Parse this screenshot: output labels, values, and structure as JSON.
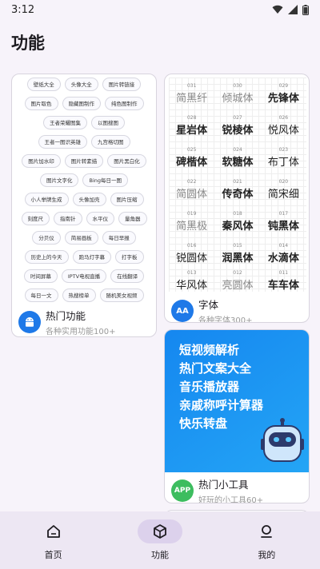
{
  "status_bar": {
    "time": "3:12"
  },
  "page": {
    "title": "功能"
  },
  "hot": {
    "chips": [
      "壁纸大全",
      "头像大全",
      "图片转链接",
      "图片取色",
      "隐藏图制作",
      "纯色图制作",
      "王者荣耀图集",
      "以图搜图",
      "王者一图识英雄",
      "九宫格切图",
      "图片加水印",
      "图片转素描",
      "图片黑白化",
      "图片文字化",
      "Bing每日一图",
      "小人举牌生成",
      "头像加壳",
      "图片压缩",
      "刻度尺",
      "指南针",
      "水平仪",
      "量角器",
      "分贝仪",
      "简易画板",
      "每日早报",
      "历史上的今天",
      "跑马灯字幕",
      "打字板",
      "时间屏幕",
      "IPTV电视直播",
      "在线翻译",
      "每日一文",
      "热搜榜单",
      "随机美女视频"
    ],
    "title": "热门功能",
    "subtitle": "各种实用功能100+",
    "badge_icon": "android-icon"
  },
  "fonts": {
    "cells": [
      {
        "num": "031",
        "name": "简黑纤"
      },
      {
        "num": "030",
        "name": "倾城体"
      },
      {
        "num": "029",
        "name": "先锋体"
      },
      {
        "num": "028",
        "name": "星岩体"
      },
      {
        "num": "027",
        "name": "锐棱体"
      },
      {
        "num": "026",
        "name": "悦风体"
      },
      {
        "num": "025",
        "name": "碑楷体"
      },
      {
        "num": "024",
        "name": "软糖体"
      },
      {
        "num": "023",
        "name": "布丁体"
      },
      {
        "num": "022",
        "name": "简圆体"
      },
      {
        "num": "021",
        "name": "传奇体"
      },
      {
        "num": "020",
        "name": "简宋细"
      },
      {
        "num": "019",
        "name": "简黑极"
      },
      {
        "num": "018",
        "name": "秦风体"
      },
      {
        "num": "017",
        "name": "钝黑体"
      },
      {
        "num": "016",
        "name": "锐圆体"
      },
      {
        "num": "015",
        "name": "润黑体"
      },
      {
        "num": "014",
        "name": "水滴体"
      },
      {
        "num": "013",
        "name": "华风体"
      },
      {
        "num": "012",
        "name": "亮圆体"
      },
      {
        "num": "011",
        "name": "车车体"
      }
    ],
    "title": "字体",
    "subtitle": "各种字体300+",
    "badge_text": "AA"
  },
  "tools": {
    "lines": [
      "短视频解析",
      "热门文案大全",
      "音乐播放器",
      "亲戚称呼计算器",
      "快乐转盘"
    ],
    "title": "热门小工具",
    "subtitle": "好玩的小工具60+",
    "badge_text": "APP",
    "banner_icon": "robot-icon"
  },
  "nav": {
    "items": [
      {
        "label": "首页",
        "icon": "home-icon"
      },
      {
        "label": "功能",
        "icon": "cube-icon"
      },
      {
        "label": "我的",
        "icon": "person-icon"
      }
    ],
    "active_index": 1
  },
  "colors": {
    "accent": "#1e79e8",
    "green_badge": "#3dbd5f",
    "banner": "#1587f0",
    "nav_active": "#dcd1ec"
  }
}
